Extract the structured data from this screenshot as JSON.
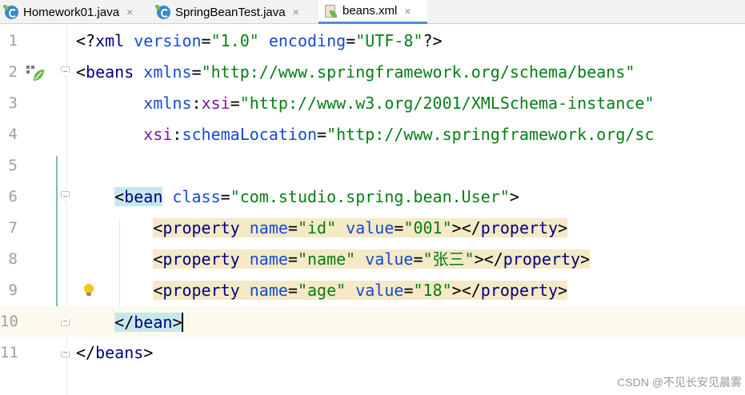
{
  "tabs": [
    {
      "label": "Homework01.java",
      "icon": "java-class-icon"
    },
    {
      "label": "SpringBeanTest.java",
      "icon": "java-class-icon"
    },
    {
      "label": "beans.xml",
      "icon": "spring-xml-icon",
      "active": true
    }
  ],
  "tab_close_glyph": "×",
  "editor": {
    "current_line": 10,
    "lines": [
      {
        "number": "1"
      },
      {
        "number": "2"
      },
      {
        "number": "3"
      },
      {
        "number": "4"
      },
      {
        "number": "5"
      },
      {
        "number": "6"
      },
      {
        "number": "7"
      },
      {
        "number": "8"
      },
      {
        "number": "9"
      },
      {
        "number": "10"
      },
      {
        "number": "11"
      }
    ],
    "code": {
      "l1": {
        "pi_open": "<?",
        "pi_name": "xml",
        "attr1": " version",
        "eq1": "=",
        "val1": "\"1.0\"",
        "attr2": " encoding",
        "eq2": "=",
        "val2": "\"UTF-8\"",
        "pi_close": "?>"
      },
      "l2": {
        "open": "<",
        "tag": "beans",
        "attr": " xmlns",
        "eq": "=",
        "val": "\"http://www.springframework.org/schema/beans\""
      },
      "l3": {
        "indent": "       ",
        "ns": "xmlns",
        "colon": ":",
        "attr": "xsi",
        "eq": "=",
        "val": "\"http://www.w3.org/2001/XMLSchema-instance\""
      },
      "l4": {
        "indent": "       ",
        "ns": "xsi",
        "colon": ":",
        "attr": "schemaLocation",
        "eq": "=",
        "val": "\"http://www.springframework.org/sc"
      },
      "l6": {
        "indent": "    ",
        "open": "<",
        "tag": "bean",
        "attr": " class",
        "eq": "=",
        "val": "\"com.studio.spring.bean.User\"",
        "close": ">"
      },
      "l7": {
        "indent": "        ",
        "open": "<",
        "tag": "property",
        "a1": " name",
        "e1": "=",
        "v1": "\"id\"",
        "a2": " value",
        "e2": "=",
        "v2": "\"001\"",
        "close_open": "></",
        "ctag": "property",
        "close": ">"
      },
      "l8": {
        "indent": "        ",
        "open": "<",
        "tag": "property",
        "a1": " name",
        "e1": "=",
        "v1": "\"name\"",
        "a2": " value",
        "e2": "=",
        "v2": "\"张三\"",
        "close_open": "></",
        "ctag": "property",
        "close": ">"
      },
      "l9": {
        "indent": "        ",
        "open": "<",
        "tag": "property",
        "a1": " name",
        "e1": "=",
        "v1": "\"age\"",
        "a2": " value",
        "e2": "=",
        "v2": "\"18\"",
        "close_open": "></",
        "ctag": "property",
        "close": ">"
      },
      "l10": {
        "indent": "    ",
        "open": "</",
        "tag": "bean",
        "close": ">"
      },
      "l11": {
        "open": "</",
        "tag": "beans",
        "close": ">"
      }
    }
  },
  "watermark": "CSDN @不见长安见晨雾",
  "colors": {
    "tag": "#00007f",
    "attribute": "#174ad4",
    "namespace": "#7a1a9c",
    "string": "#067d17",
    "tab_active_underline": "#4a8fd9"
  }
}
